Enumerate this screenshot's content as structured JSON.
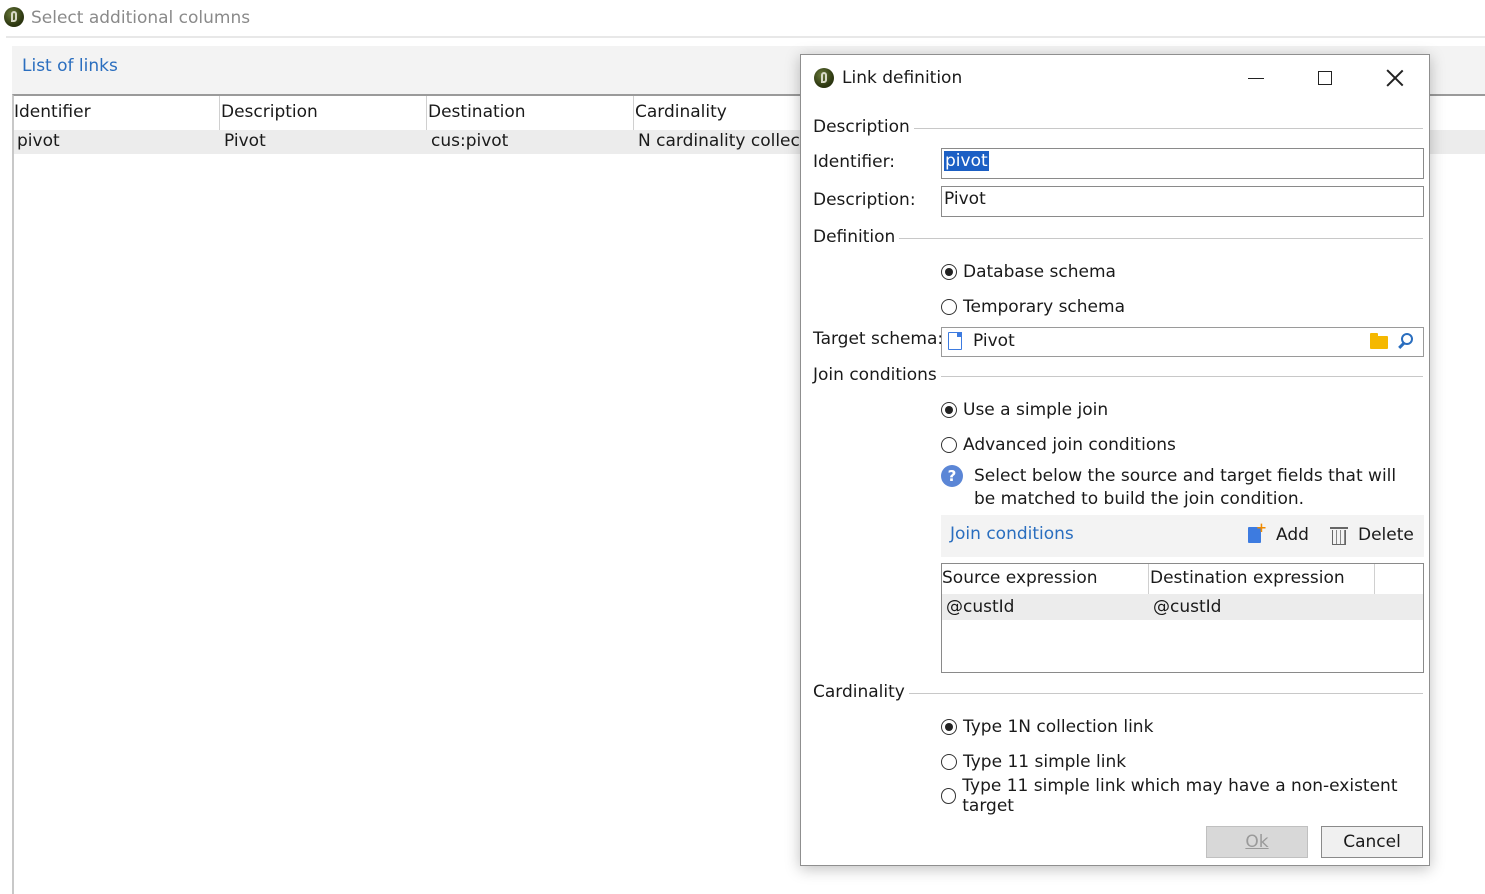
{
  "background_window": {
    "title": "Select additional columns",
    "panel_title": "List of links",
    "columns": [
      "Identifier",
      "Description",
      "Destination",
      "Cardinality"
    ],
    "rows": [
      {
        "identifier": "pivot",
        "description": "Pivot",
        "destination": "cus:pivot",
        "cardinality": "N cardinality collecti"
      }
    ]
  },
  "dialog": {
    "title": "Link definition",
    "description_section": {
      "label": "Description",
      "identifier_label": "Identifier:",
      "identifier_value": "pivot",
      "description_label": "Description:",
      "description_value": "Pivot"
    },
    "definition_section": {
      "label": "Definition",
      "options": [
        "Database schema",
        "Temporary schema"
      ],
      "selected": "Database schema",
      "target_schema_label": "Target schema:",
      "target_schema_value": "Pivot"
    },
    "join_section": {
      "label": "Join conditions",
      "options": [
        "Use a simple join",
        "Advanced join conditions"
      ],
      "selected": "Use a simple join",
      "help_text": "Select below the source and target fields that will be matched to build the join condition.",
      "panel_title": "Join conditions",
      "add_label": "Add",
      "delete_label": "Delete",
      "columns": [
        "Source expression",
        "Destination expression"
      ],
      "rows": [
        {
          "source": "@custId",
          "destination": "@custId"
        }
      ]
    },
    "cardinality_section": {
      "label": "Cardinality",
      "options": [
        "Type 1N collection link",
        "Type 11 simple link",
        "Type 11 simple link which may have a non-existent target"
      ],
      "selected": "Type 1N collection link"
    },
    "ok_label": "Ok",
    "cancel_label": "Cancel"
  },
  "colors": {
    "accent": "#2a6ebf",
    "selection": "#1c5fc4",
    "row_highlight": "#ececec"
  }
}
